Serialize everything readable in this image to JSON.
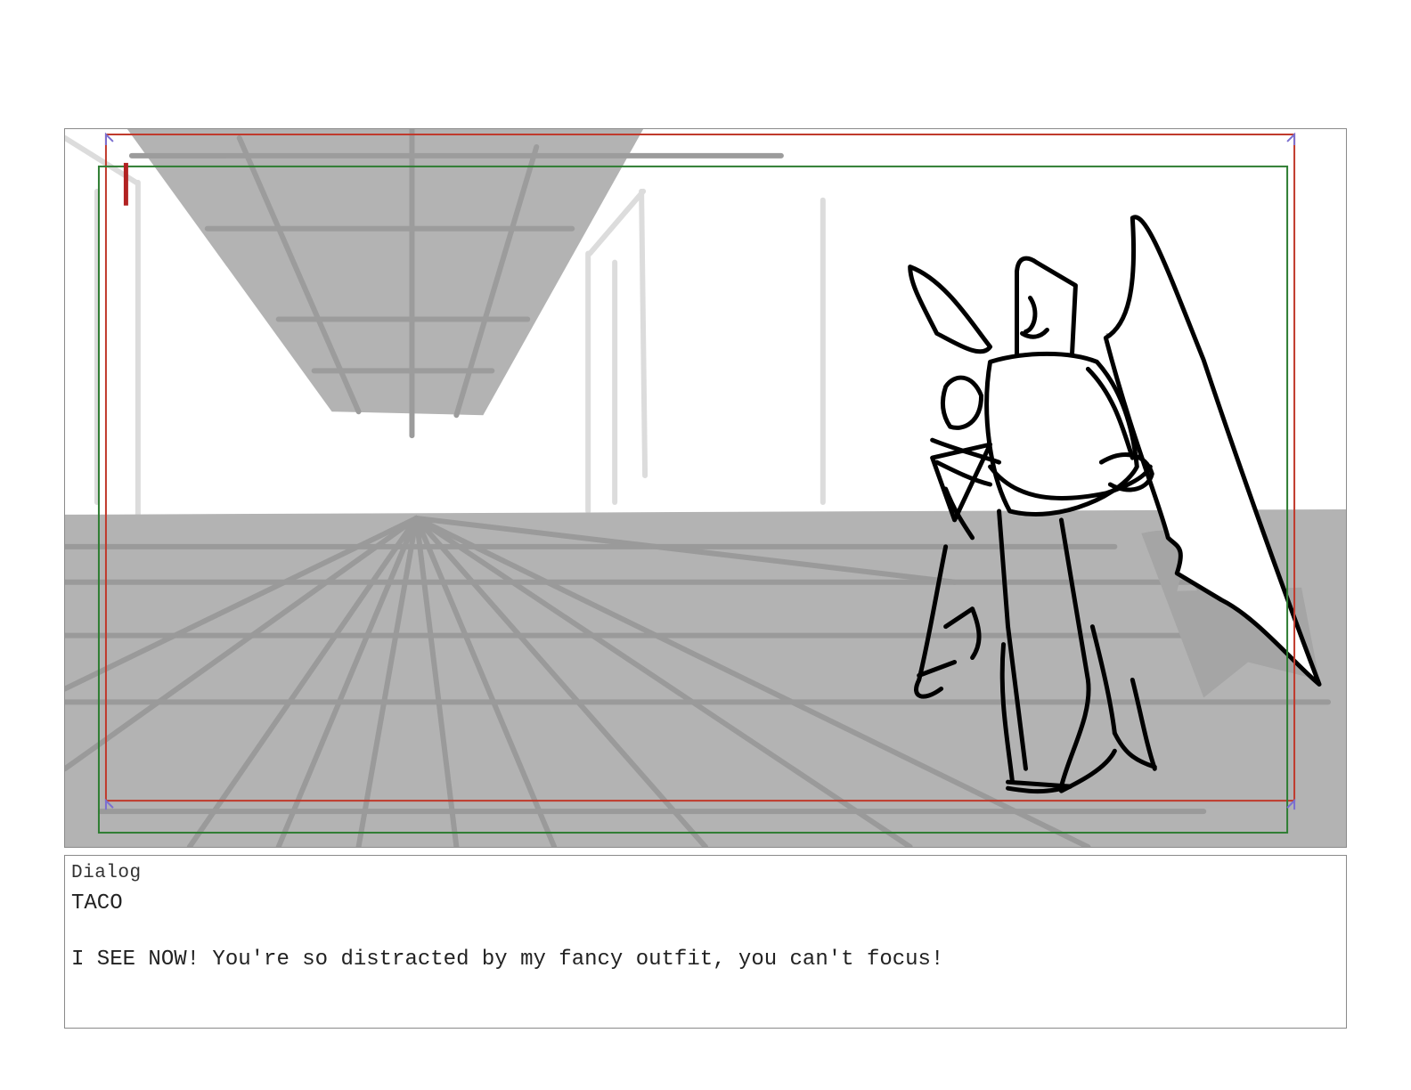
{
  "storyboard": {
    "panel": {
      "icons": {
        "sketch": "storyboard-sketch-icon",
        "character": "winged-character-icon"
      },
      "colors": {
        "safe_frame_red": "#c0392b",
        "safe_frame_green": "#2e7d32",
        "sketch_gray": "#b3b3b3",
        "ink": "#000000"
      }
    },
    "dialog": {
      "label": "Dialog",
      "character": "TACO",
      "line": "I SEE NOW! You're so distracted by my fancy outfit, you can't focus!"
    }
  }
}
